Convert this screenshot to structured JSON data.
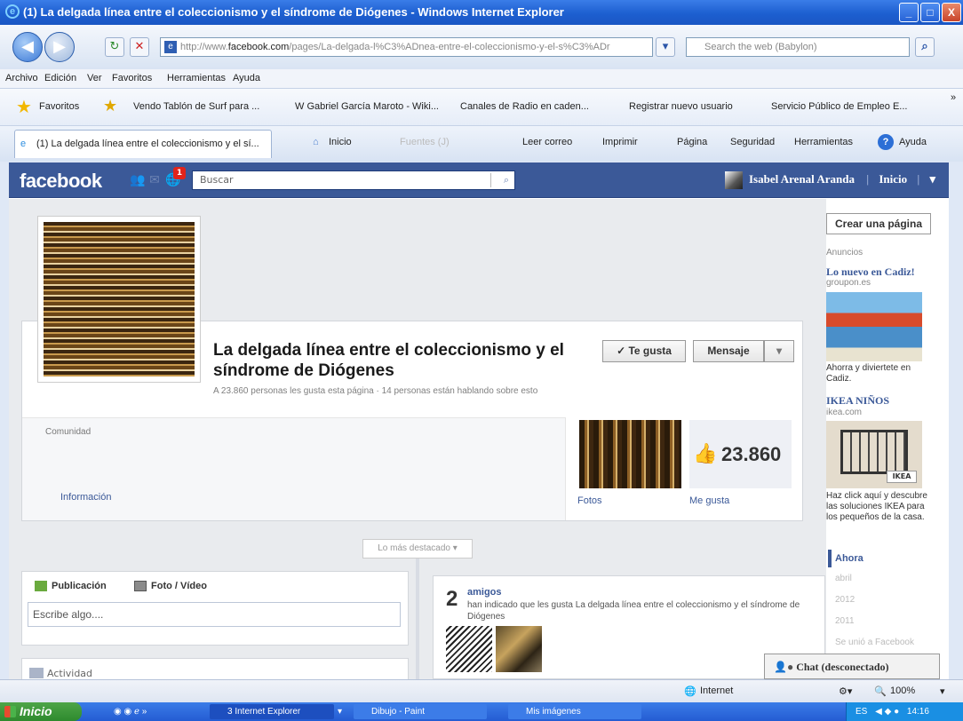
{
  "window": {
    "title": "(1) La delgada línea entre el coleccionismo y el síndrome de Diógenes - Windows Internet Explorer",
    "min": "_",
    "max": "□",
    "close": "X"
  },
  "address": {
    "url_prefix": "http://www.",
    "url_domain": "facebook.com",
    "url_rest": "/pages/La-delgada-l%C3%ADnea-entre-el-coleccionismo-y-el-s%C3%ADr",
    "search_placeholder": "Search the web (Babylon)"
  },
  "menu": [
    "Archivo",
    "Edición",
    "Ver",
    "Favoritos",
    "Herramientas",
    "Ayuda"
  ],
  "favorites": {
    "label": "Favoritos",
    "items": [
      "Vendo Tablón de Surf para ...",
      "Gabriel García Maroto - Wiki...",
      "Canales de Radio en caden...",
      "Registrar nuevo usuario",
      "Servicio Público de Empleo E..."
    ]
  },
  "tabs": {
    "active": "(1) La delgada línea entre el coleccionismo y el sí...",
    "tools": [
      "Inicio",
      "Fuentes (J)",
      "Leer correo",
      "Imprimir",
      "Página",
      "Seguridad",
      "Herramientas",
      "Ayuda"
    ]
  },
  "fb": {
    "logo": "facebook",
    "notifications": "1",
    "search_placeholder": "Buscar",
    "user": "Isabel Arenal Aranda",
    "home": "Inicio",
    "page_title": "La delgada línea entre el coleccionismo y el síndrome de Diógenes",
    "likes_line": "A 23.860 personas les gusta esta página · 14 personas están hablando sobre esto",
    "like_button": "✓ Te gusta",
    "message_button": "Mensaje",
    "category": "Comunidad",
    "info_link": "Información",
    "photos_link": "Fotos",
    "likes_link": "Me gusta",
    "likes_count": "23.860",
    "highlights": "Lo más destacado ▾",
    "publish": "Publicación",
    "photo_video": "Foto / Vídeo",
    "write_placeholder": "Escribe algo....",
    "activity": "Actividad",
    "friends_count": "2",
    "friends_title": "amigos",
    "friends_desc": "han indicado que les gusta La delgada línea entre el coleccionismo y el síndrome de Diógenes",
    "create_page": "Crear una página",
    "ads_label": "Anuncios",
    "ad1_title": "Lo nuevo en Cadiz!",
    "ad1_domain": "groupon.es",
    "ad1_text": "Ahorra y diviertete en Cadiz.",
    "ad2_title": "IKEA NIÑOS",
    "ad2_domain": "ikea.com",
    "ad2_text": "Haz click aquí y descubre las soluciones IKEA para los pequeños de la casa.",
    "ikea_logo": "IKEA",
    "timeline": [
      "Ahora",
      "abril",
      "2012",
      "2011",
      "Se unió a Facebook"
    ],
    "chat": "Chat (desconectado)"
  },
  "status": {
    "zone": "Internet",
    "zoom": "100%"
  },
  "taskbar": {
    "start": "Inicio",
    "items": [
      "3 Internet Explorer",
      "Dibujo - Paint",
      "Mis imágenes"
    ],
    "lang": "ES",
    "time": "14:16"
  }
}
